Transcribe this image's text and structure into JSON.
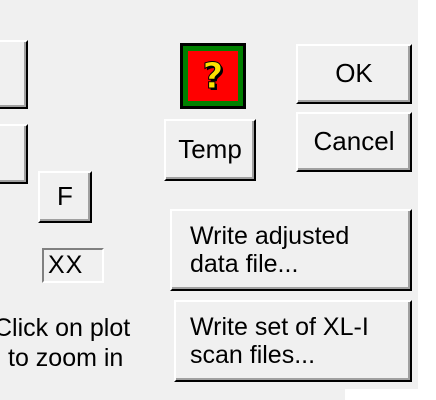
{
  "dialog": {
    "help_icon": {
      "glyph": "?",
      "icon": "question-mark-icon",
      "colors": {
        "frame": "#008000",
        "fill": "#ff0000",
        "glyph": "#ffe100"
      }
    },
    "buttons": {
      "ok": "OK",
      "cancel": "Cancel",
      "temp": "Temp",
      "f": "F",
      "write_adjusted": [
        "Write adjusted",
        "data file..."
      ],
      "write_scan": [
        "Write set of XL-I",
        "scan files..."
      ]
    },
    "xx_field": "XX",
    "hint": [
      "Click on plot",
      "to zoom in"
    ]
  }
}
